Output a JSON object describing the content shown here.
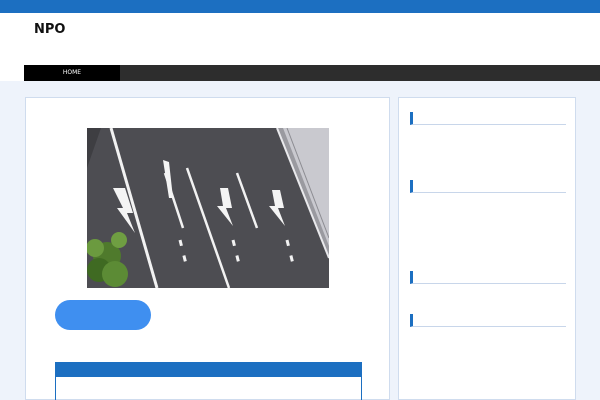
{
  "header": {
    "site_title": "NPO",
    "tagline": ""
  },
  "nav": {
    "items": [
      {
        "label": "HOME",
        "active": true
      },
      {
        "label": ""
      },
      {
        "label": ""
      },
      {
        "label": ""
      },
      {
        "label": ""
      },
      {
        "label": ""
      }
    ]
  },
  "main": {
    "hero_image": "road-lane-arrows-photo",
    "pill_button": {
      "line1": "",
      "line2": ""
    },
    "caption_link": "",
    "info_box": {
      "title": "",
      "text": ""
    }
  },
  "sidebar": {
    "widgets": [
      {
        "title": "",
        "items": [
          "",
          "",
          ""
        ]
      },
      {
        "title": "",
        "items": [
          "",
          "",
          "",
          ""
        ]
      },
      {
        "title": "",
        "items": [
          ""
        ]
      },
      {
        "title": "",
        "items": [
          "",
          "",
          "",
          ""
        ]
      }
    ]
  },
  "colors": {
    "accent": "#1c6fc1",
    "nav_bg": "#2d2d2d",
    "button": "#3f8ff0",
    "link": "#2456a6"
  }
}
